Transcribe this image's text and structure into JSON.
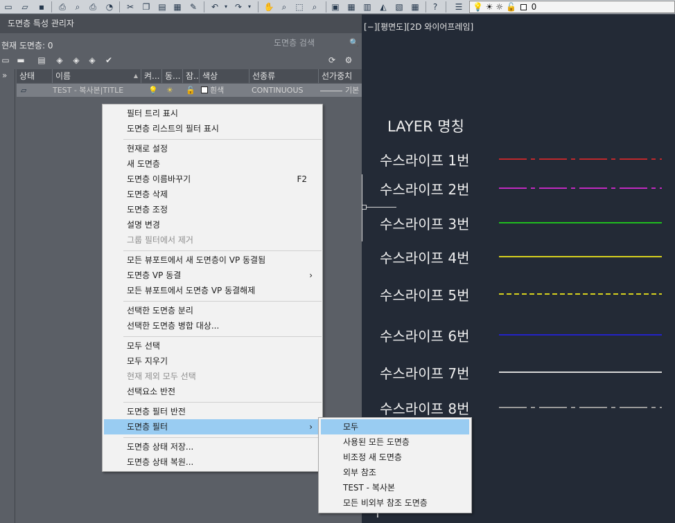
{
  "toolbar": {
    "icons": [
      "new-file-icon",
      "open-file-icon",
      "save-icon",
      "print-icon",
      "print-preview-icon",
      "plot-icon",
      "publish-icon",
      "cut-icon",
      "copy-icon",
      "paste-icon",
      "match-properties-icon",
      "brush-icon",
      "undo-icon",
      "redo-icon",
      "pan-icon",
      "zoom-realtime-icon",
      "zoom-window-icon",
      "zoom-previous-icon",
      "properties-icon",
      "design-center-icon",
      "tool-palettes-icon",
      "sheet-set-icon",
      "markup-icon",
      "calculator-icon",
      "help-icon",
      "layer-properties-icon"
    ],
    "layer_combo_value": "0"
  },
  "layer_manager": {
    "title": "도면층 특성 관리자",
    "current_layer": "현재 도면층: 0",
    "search_placeholder": "도면층 검색",
    "columns": [
      "상태",
      "이름",
      "켜...",
      "동...",
      "잠...",
      "색상",
      "선종류",
      "선가중치"
    ],
    "row": {
      "name": "TEST - 복사본|TITLE",
      "color": "흰색",
      "linetype": "CONTINUOUS",
      "lineweight": "기본"
    }
  },
  "viewport": {
    "label": "[−][평면도][2D 와이어프레임]",
    "heading": "LAYER 명칭",
    "rows": [
      {
        "label": "수스라이프 1번",
        "color": "#c0282c",
        "style": "dashdot"
      },
      {
        "label": "수스라이프 2번",
        "color": "#c22ac2",
        "style": "dashdot"
      },
      {
        "label": "수스라이프 3번",
        "color": "#1fbf1f",
        "style": "solid"
      },
      {
        "label": "수스라이프 4번",
        "color": "#d8d21e",
        "style": "solid"
      },
      {
        "label": "수스라이프 5번",
        "color": "#d8d21e",
        "style": "dashed"
      },
      {
        "label": "수스라이프 6번",
        "color": "#2323c8",
        "style": "solid"
      },
      {
        "label": "수스라이프 7번",
        "color": "#d8d8d8",
        "style": "solid"
      },
      {
        "label": "수스라이프 8번",
        "color": "#9a9a9a",
        "style": "dashdot"
      }
    ]
  },
  "context_menu": {
    "items": [
      {
        "label": "필터 트리 표시",
        "disabled": false
      },
      {
        "label": "도면층 리스트의 필터 표시",
        "disabled": false
      },
      {
        "label": "현재로 설정",
        "disabled": false
      },
      {
        "label": "새 도면층",
        "disabled": false
      },
      {
        "label": "도면층 이름바꾸기",
        "shortcut": "F2",
        "disabled": false
      },
      {
        "label": "도면층 삭제",
        "disabled": false
      },
      {
        "label": "도면층 조정",
        "disabled": false
      },
      {
        "label": "설명 변경",
        "disabled": false
      },
      {
        "label": "그룹 필터에서 제거",
        "disabled": true
      },
      {
        "label": "모든 뷰포트에서 새 도면층이 VP 동결됨",
        "disabled": false
      },
      {
        "label": "도면층 VP 동결",
        "submenu": true,
        "disabled": false
      },
      {
        "label": "모든 뷰포트에서 도면층 VP 동결해제",
        "disabled": false
      },
      {
        "label": "선택한 도면층 분리",
        "disabled": false
      },
      {
        "label": "선택한 도면층 병합 대상...",
        "disabled": false
      },
      {
        "label": "모두 선택",
        "disabled": false
      },
      {
        "label": "모두 지우기",
        "disabled": false
      },
      {
        "label": "현재 제외 모두 선택",
        "disabled": true
      },
      {
        "label": "선택요소 반전",
        "disabled": false
      },
      {
        "label": "도면층 필터 반전",
        "disabled": false
      },
      {
        "label": "도면층 필터",
        "submenu": true,
        "highlighted": true,
        "disabled": false
      },
      {
        "label": "도면층 상태 저장...",
        "disabled": false
      },
      {
        "label": "도면층 상태 복원...",
        "disabled": false
      }
    ]
  },
  "submenu": {
    "items": [
      {
        "label": "모두",
        "highlighted": true
      },
      {
        "label": "사용된 모든 도면층"
      },
      {
        "label": "비조정 새 도면층"
      },
      {
        "label": "외부 참조"
      },
      {
        "label": "TEST - 복사본"
      },
      {
        "label": "모든 비외부 참조 도면층"
      }
    ]
  }
}
